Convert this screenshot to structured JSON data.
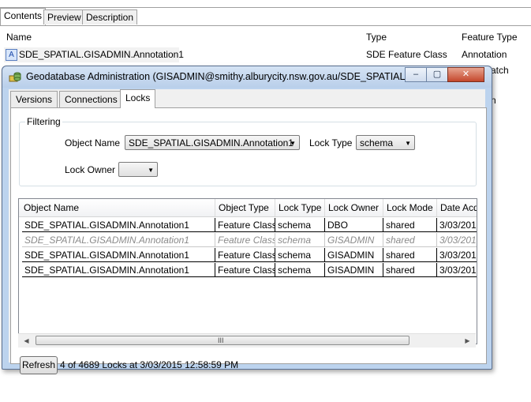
{
  "catalog": {
    "tabs": [
      "Contents",
      "Preview",
      "Description"
    ],
    "active_tab": "Contents",
    "columns": [
      "Name",
      "Type",
      "Feature Type"
    ],
    "row": {
      "name": "SDE_SPATIAL.GISADMIN.Annotation1",
      "type": "SDE Feature Class",
      "feature_type": "Annotation"
    },
    "partial_texts": [
      "atch",
      "n"
    ],
    "icon_letter": "A"
  },
  "dialog": {
    "title": "Geodatabase Administration (GISADMIN@smithy.alburycity.nsw.gov.au/SDE_SPATIAL)",
    "buttons": {
      "minimize": "–",
      "maximize": "▢",
      "close": "✕"
    },
    "tabs": [
      "Versions",
      "Connections",
      "Locks"
    ],
    "active_tab": "Locks",
    "filtering": {
      "legend": "Filtering",
      "object_name_label": "Object Name",
      "object_name_value": "SDE_SPATIAL.GISADMIN.Annotation1",
      "lock_type_label": "Lock Type",
      "lock_type_value": "schema",
      "lock_owner_label": "Lock Owner",
      "lock_owner_value": ""
    },
    "table": {
      "columns": [
        "Object Name",
        "Object Type",
        "Lock Type",
        "Lock Owner",
        "Lock Mode",
        "Date Acq"
      ],
      "rows": [
        {
          "object_name": "SDE_SPATIAL.GISADMIN.Annotation1",
          "object_type": "Feature Class",
          "lock_type": "schema",
          "lock_owner": "DBO",
          "lock_mode": "shared",
          "date": "3/03/201",
          "dim": false
        },
        {
          "object_name": "SDE_SPATIAL.GISADMIN.Annotation1",
          "object_type": "Feature Class",
          "lock_type": "schema",
          "lock_owner": "GISADMIN",
          "lock_mode": "shared",
          "date": "3/03/201",
          "dim": true
        },
        {
          "object_name": "SDE_SPATIAL.GISADMIN.Annotation1",
          "object_type": "Feature Class",
          "lock_type": "schema",
          "lock_owner": "GISADMIN",
          "lock_mode": "shared",
          "date": "3/03/201",
          "dim": false
        },
        {
          "object_name": "SDE_SPATIAL.GISADMIN.Annotation1",
          "object_type": "Feature Class",
          "lock_type": "schema",
          "lock_owner": "GISADMIN",
          "lock_mode": "shared",
          "date": "3/03/201",
          "dim": false
        }
      ]
    },
    "scroll": {
      "left": "◀",
      "right": "▶",
      "grip": "III"
    },
    "refresh_label": "Refresh",
    "status": "4 of 4689 Locks at 3/03/2015 12:58:59 PM",
    "dropdown_arrow": "▼"
  }
}
